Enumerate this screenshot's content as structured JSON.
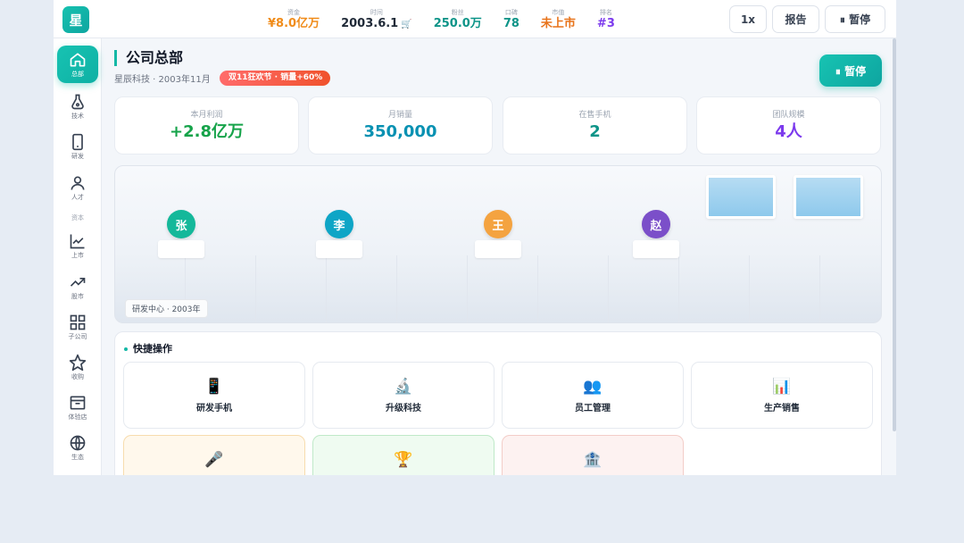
{
  "logo": "星",
  "stats": [
    {
      "label": "资金",
      "value": "¥8.0亿万",
      "color": "#f08c1a"
    },
    {
      "label": "时间",
      "value": "2003.6.1",
      "color": "#1f2937"
    },
    {
      "label": "粉丝",
      "value": "250.0万",
      "color": "#0d9488"
    },
    {
      "label": "口碑",
      "value": "78",
      "color": "#0d9488"
    },
    {
      "label": "市值",
      "value": "未上市",
      "color": "#e8731a"
    },
    {
      "label": "排名",
      "value": "#3",
      "color": "#7c3aed"
    }
  ],
  "topbar": {
    "speed": "1x",
    "report": "报告",
    "pause": "⏸ 暂停"
  },
  "sidebar": {
    "items": [
      {
        "label": "总部",
        "icon": "home-icon"
      },
      {
        "label": "技术",
        "icon": "flask-icon"
      },
      {
        "label": "研发",
        "icon": "phone-icon"
      },
      {
        "label": "人才",
        "icon": "user-icon"
      },
      {
        "label": "上市",
        "icon": "chart-line-icon"
      },
      {
        "label": "股市",
        "icon": "trend-icon"
      },
      {
        "label": "子公司",
        "icon": "grid-icon"
      },
      {
        "label": "收购",
        "icon": "star-icon"
      },
      {
        "label": "体验店",
        "icon": "store-icon"
      },
      {
        "label": "生态",
        "icon": "globe-icon"
      }
    ],
    "section_label": "资本"
  },
  "page": {
    "title": "公司总部",
    "subtitle": "星辰科技 · 2003年11月",
    "event_badge": "双11狂欢节 · 销量+60%",
    "pause_button": "⏸ 暂停"
  },
  "cards": [
    {
      "label": "本月利润",
      "value": "+2.8亿万",
      "color": "#16a34a"
    },
    {
      "label": "月销量",
      "value": "350,000",
      "color": "#0891b2"
    },
    {
      "label": "在售手机",
      "value": "2",
      "color": "#0d9488"
    },
    {
      "label": "团队规模",
      "value": "4人",
      "color": "#7c3aed"
    }
  ],
  "scene": {
    "employees": [
      {
        "name": "张",
        "color": "#14b89a"
      },
      {
        "name": "李",
        "color": "#0ea5c6"
      },
      {
        "name": "王",
        "color": "#f4a340"
      },
      {
        "name": "赵",
        "color": "#7b4fc9"
      }
    ],
    "caption": "研发中心 · 2003年"
  },
  "quick": {
    "title": "快捷操作",
    "actions": [
      {
        "label": "研发手机",
        "icon": "📱"
      },
      {
        "label": "升级科技",
        "icon": "🔬"
      },
      {
        "label": "员工管理",
        "icon": "👥"
      },
      {
        "label": "生产销售",
        "icon": "📊"
      },
      {
        "label": "",
        "icon": "🎤"
      },
      {
        "label": "",
        "icon": "🏆"
      },
      {
        "label": "",
        "icon": "🏦"
      }
    ]
  }
}
